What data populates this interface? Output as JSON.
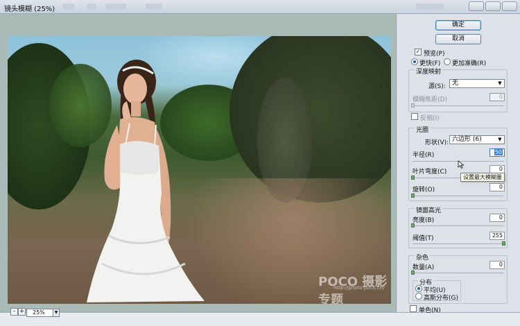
{
  "window": {
    "title": "镜头模糊 (25%)"
  },
  "buttons": {
    "ok": "确定",
    "cancel": "取消"
  },
  "preview": {
    "checkbox_label": "预览(P)",
    "checked": true,
    "modes": [
      {
        "label": "更快(F)",
        "selected": true
      },
      {
        "label": "更加准确(R)",
        "selected": false
      }
    ]
  },
  "depth_map": {
    "title": "深度映射",
    "source_label": "源(S):",
    "source_value": "无",
    "focal_label": "模糊焦距(D)",
    "focal_value": "0",
    "invert_label": "反相(I)"
  },
  "iris": {
    "title": "光圈",
    "shape_label": "形状(V):",
    "shape_value": "六边形 (6)",
    "radius_label": "半径(R)",
    "radius_value": "50",
    "blade_label": "叶片弯度(C)",
    "blade_value": "0",
    "rotation_label": "旋转(O)",
    "rotation_value": "0",
    "tooltip": "设置最大模糊量"
  },
  "specular": {
    "title": "镜面高光",
    "brightness_label": "亮度(B)",
    "brightness_value": "0",
    "threshold_label": "阈值(T)",
    "threshold_value": "255"
  },
  "noise": {
    "title": "杂色",
    "amount_label": "数量(A)",
    "amount_value": "0",
    "distribution_title": "分布",
    "distribution": [
      {
        "label": "平均(U)",
        "selected": true
      },
      {
        "label": "高斯分布(G)",
        "selected": false
      }
    ],
    "mono_label": "单色(N)"
  },
  "statusbar": {
    "zoom_out": "-",
    "zoom_in": "+",
    "zoom_value": "25%"
  },
  "watermark": {
    "brand": "POCO 摄影专题",
    "url": "http://photo.poco.cn/"
  },
  "colors": {
    "panel_bg": "#dde2e8",
    "stage_bg": "#aabbb7",
    "accent": "#3584e4",
    "slider_thumb": "#6da86a"
  }
}
